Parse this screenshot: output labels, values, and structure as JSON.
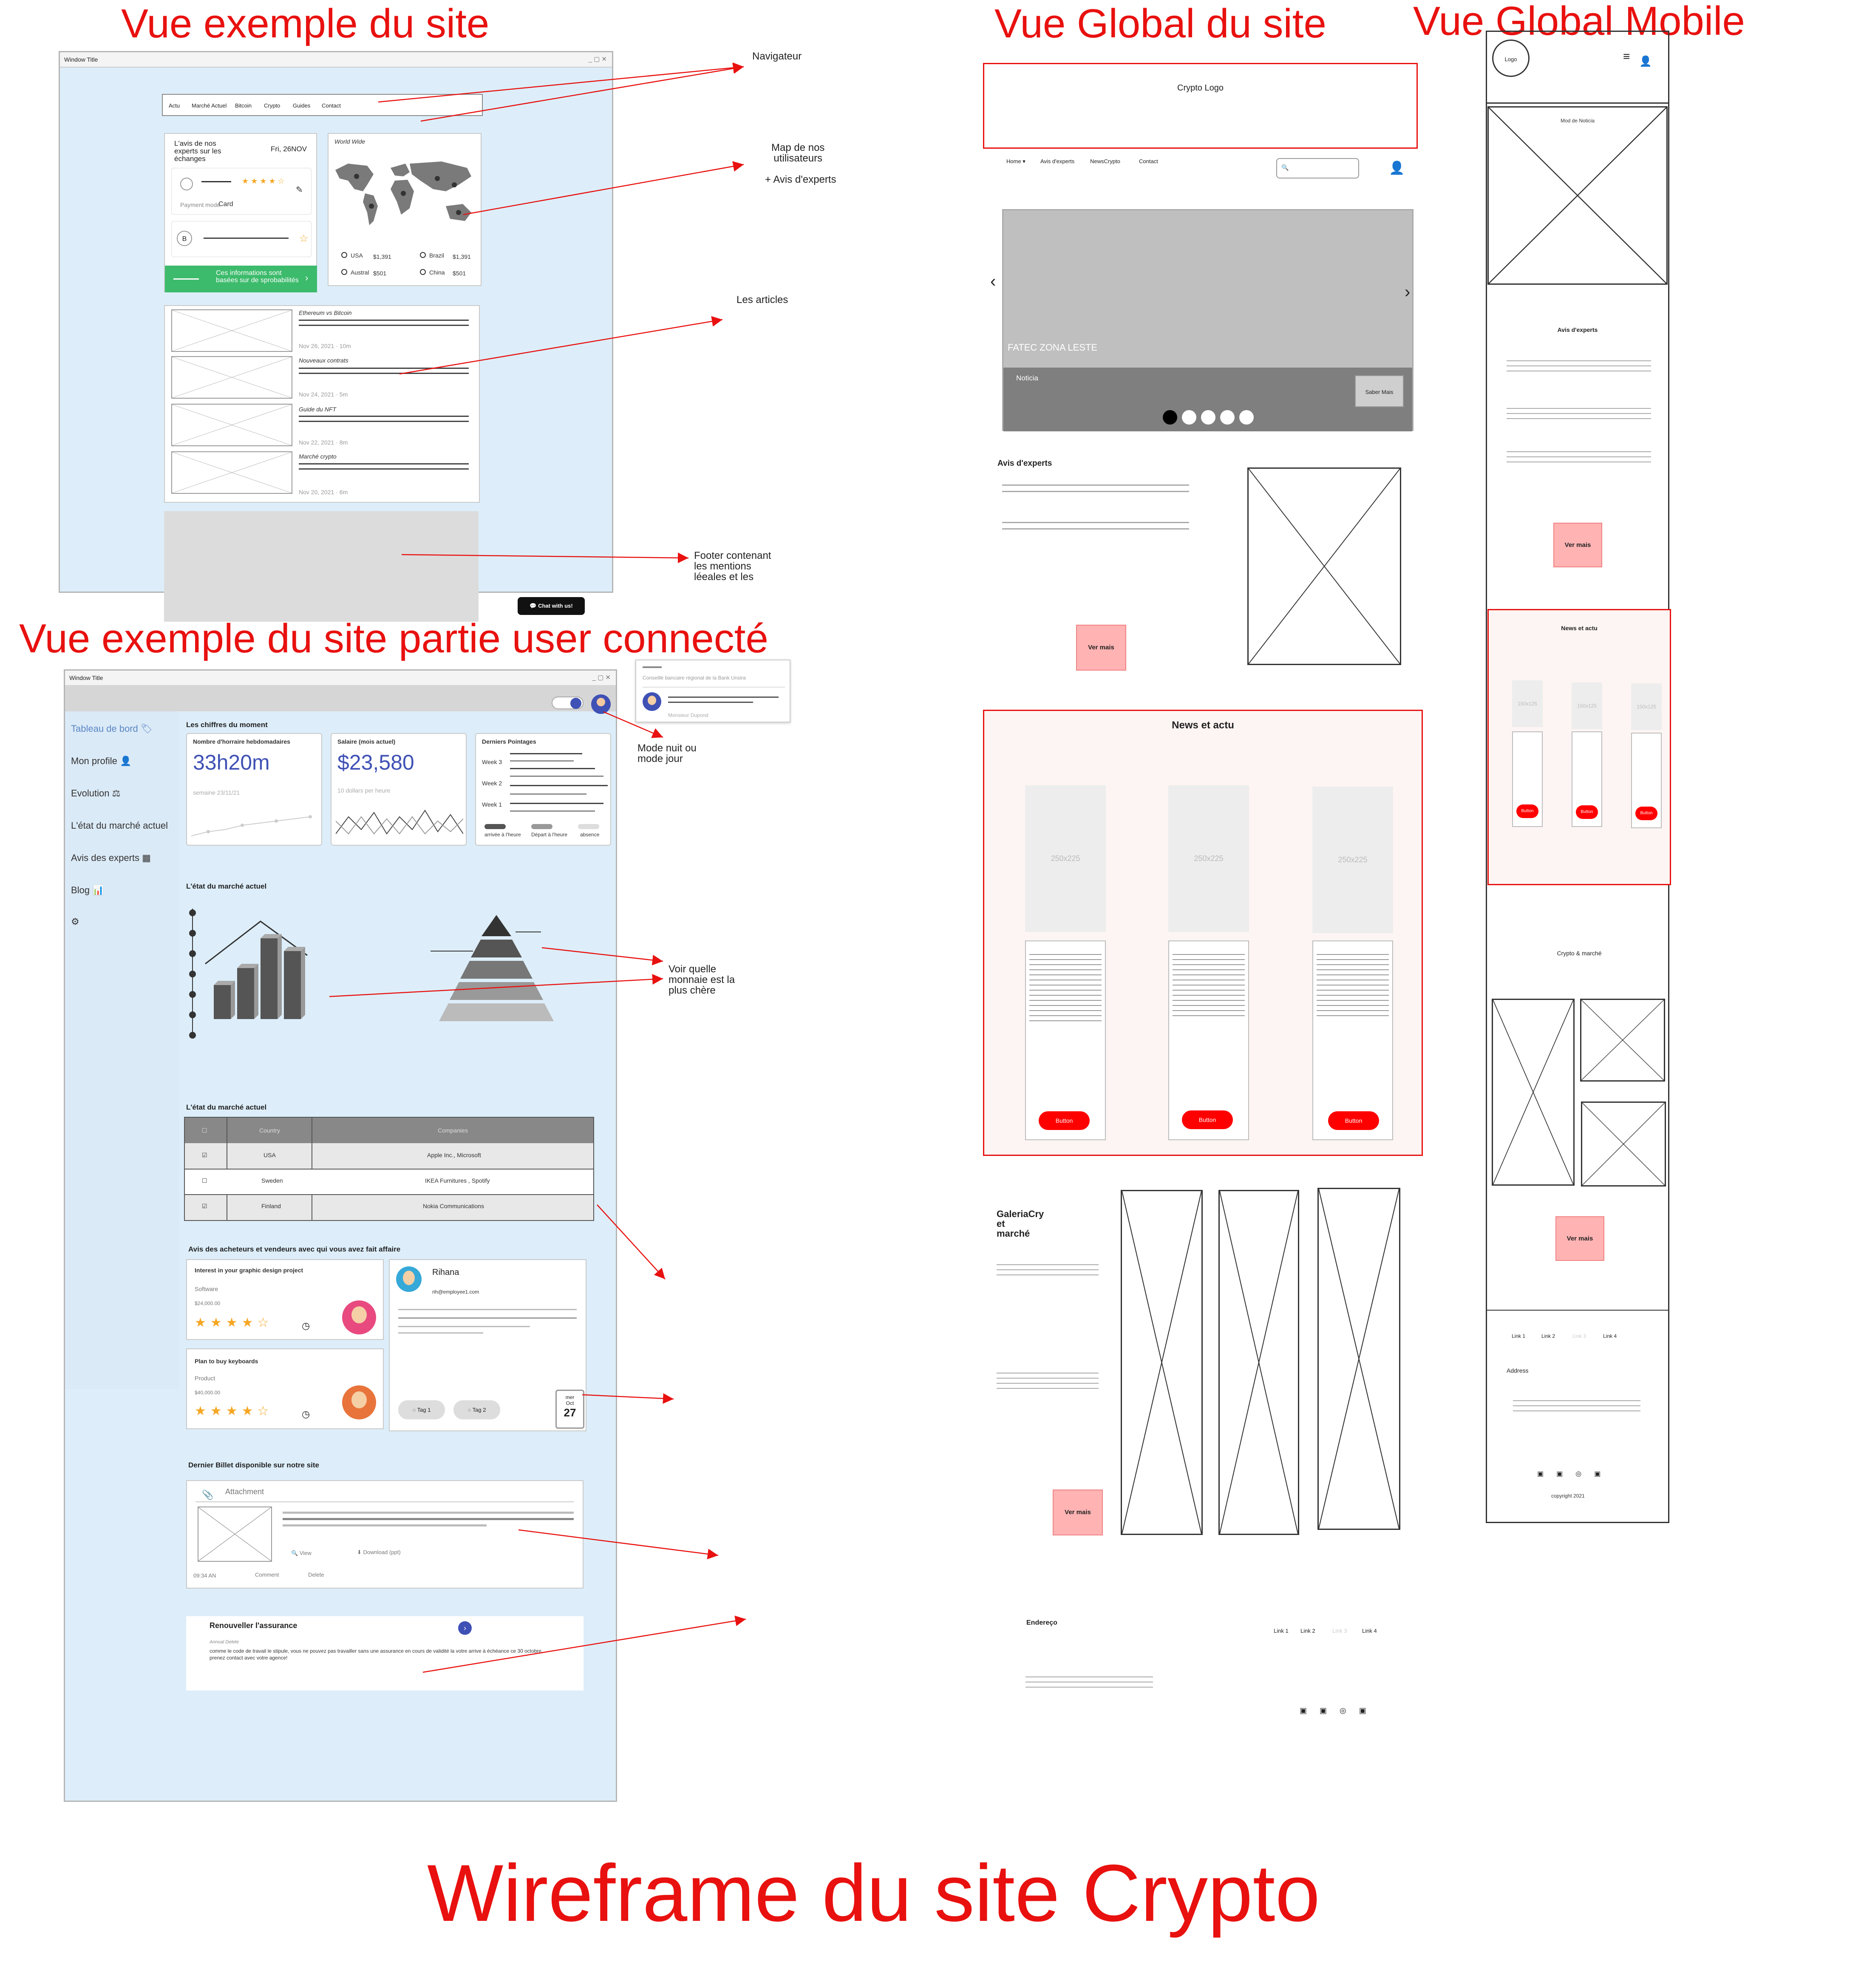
{
  "titles": {
    "example_site": "Vue exemple du site",
    "global_site": "Vue Global du site",
    "global_mobile": "Vue Global Mobile",
    "user_connected": "Vue exemple du site partie user connecté",
    "main": "Wireframe du site Crypto"
  },
  "window_title": "Window Title",
  "window_controls": "_ ▢ ✕",
  "annotations": {
    "navigateur": "Navigateur",
    "map_users": "Map de nos\nutilisateurs",
    "avis_experts": "+ Avis d'experts",
    "articles": "Les articles",
    "footer": "Footer contenant\nles mentions\nléeales et les",
    "mode_nuit": "Mode nuit ou\nmode jour",
    "voir_monnaie": "Voir quelle\nmonnaie est la\nplus chère"
  },
  "example": {
    "nav": [
      "Actu",
      "Marché Actuel",
      "Bitcoin",
      "Crypto",
      "Guides",
      "Contact"
    ],
    "expert_card": {
      "title": "L'avis de nos\nexperts sur les\néchanges",
      "date": "Fri, 26NOV",
      "payment_mode_label": "Payment mode",
      "payment_mode_value": "Card",
      "avatar_letter": "B",
      "banner": "Ces informations sont\nbasées sur de sprobabilités"
    },
    "map_card": {
      "title": "World Wide",
      "items": [
        {
          "country": "USA",
          "value": "$1,391"
        },
        {
          "country": "Brazil",
          "value": "$1,391"
        },
        {
          "country": "Austral",
          "value": "$501"
        },
        {
          "country": "China",
          "value": "$501"
        }
      ]
    },
    "articles": [
      {
        "title": "Ethereum vs Bitcoin",
        "meta": "Nov 26, 2021 · 10m"
      },
      {
        "title": "Nouveaux contrats",
        "meta": "Nov 24, 2021 · 5m"
      },
      {
        "title": "Guide du NFT",
        "meta": "Nov 22, 2021 · 8m"
      },
      {
        "title": "Marché crypto",
        "meta": "Nov 20, 2021 · 6m"
      }
    ],
    "chat_button": "Chat with us!"
  },
  "connected": {
    "popup": {
      "line1": "Conseillé bancaire régional de la Bank Unsira",
      "name": "Monsieur Dupond"
    },
    "sidebar": [
      "Tableau de bord",
      "Mon profile",
      "Evolution",
      "L'état du marché actuel",
      "Avis des experts",
      "Blog"
    ],
    "section_numbers": "Les chiffres du moment",
    "hours": {
      "title": "Nombre d'horraire hebdomadaires",
      "value": "33h20m",
      "sub": "semaine 23/11/21"
    },
    "salary": {
      "title": "Salaire (mois actuel)",
      "value": "$23,580",
      "sub": "10 dollars per heure"
    },
    "pointages": {
      "title": "Derniers Pointages",
      "weeks": [
        "Week 3",
        "Week 2",
        "Week 1"
      ],
      "legend": [
        "arrivée à l'heure",
        "Départ à l'heure",
        "absence"
      ]
    },
    "market_title": "L'état du marché actuel",
    "table": {
      "title": "L'état du marché actuel",
      "headers": [
        "",
        "Country",
        "Companies"
      ],
      "rows": [
        {
          "check": "☑",
          "country": "USA",
          "company": "Apple Inc., Microsoft"
        },
        {
          "check": "☐",
          "country": "Sweden",
          "company": "IKEA Furnitures , Spotify"
        },
        {
          "check": "☑",
          "country": "Finland",
          "company": "Nokia Communications"
        }
      ]
    },
    "reviews_title": "Avis des acheteurs et vendeurs avec qui vous avez fait affaire",
    "review1": {
      "title": "Interest in your graphic design project",
      "category": "Software",
      "price": "$24,000.00"
    },
    "review2": {
      "title": "Plan to buy keyboards",
      "category": "Product",
      "price": "$40,000.00"
    },
    "contact": {
      "name": "Rihana",
      "email": "rih@employee1.com",
      "tags": [
        "Tag 1",
        "Tag 2"
      ],
      "cal_day": "mer",
      "cal_month": "Oct",
      "cal_date": "27"
    },
    "billet_title": "Dernier Billet disponible sur notre site",
    "attachment": {
      "label": "Attachment",
      "view": "View",
      "download": "Download (ppt)",
      "time": "09:34 AN",
      "comment": "Comment",
      "delete": "Delete"
    },
    "assurance": {
      "title": "Renouveller l'assurance",
      "sub": "Annual Delete",
      "text": "comme le code de travail le stipule, vous ne pouvez pas travailler sans une assurance en cours de validité la votre arrive à échéance ce 30 octobre,\nprenez contact avec votre agence!"
    }
  },
  "global": {
    "logo": "Crypto Logo",
    "nav": [
      "Home ▾",
      "Avis d'experts",
      "NewsCrypto",
      "Contact"
    ],
    "carousel": {
      "headline": "FATEC ZONA LESTE",
      "caption": "Noticia",
      "button": "Saber Mais"
    },
    "experts_title": "Avis d'experts",
    "ver_mais": "Ver mais",
    "news_title": "News et actu",
    "news_placeholder": "250x225",
    "button": "Button",
    "gallery_title": "GaleriaCry\net\nmarché",
    "footer_title": "Endereço",
    "footer_links": [
      "Link 1",
      "Link 2",
      "Link 3",
      "Link 4"
    ]
  },
  "mobile": {
    "logo": "Logo",
    "feed_title": "Mod de Noticia",
    "experts_title": "Avis d'experts",
    "ver_mais": "Ver mais",
    "news_title": "News et actu",
    "news_placeholder": "150x125",
    "button": "Button",
    "crypto_title": "Crypto & marché",
    "links": [
      "Link 1",
      "Link 2",
      "Link 3",
      "Link 4"
    ],
    "address": "Address",
    "copyright": "copyright 2021"
  }
}
